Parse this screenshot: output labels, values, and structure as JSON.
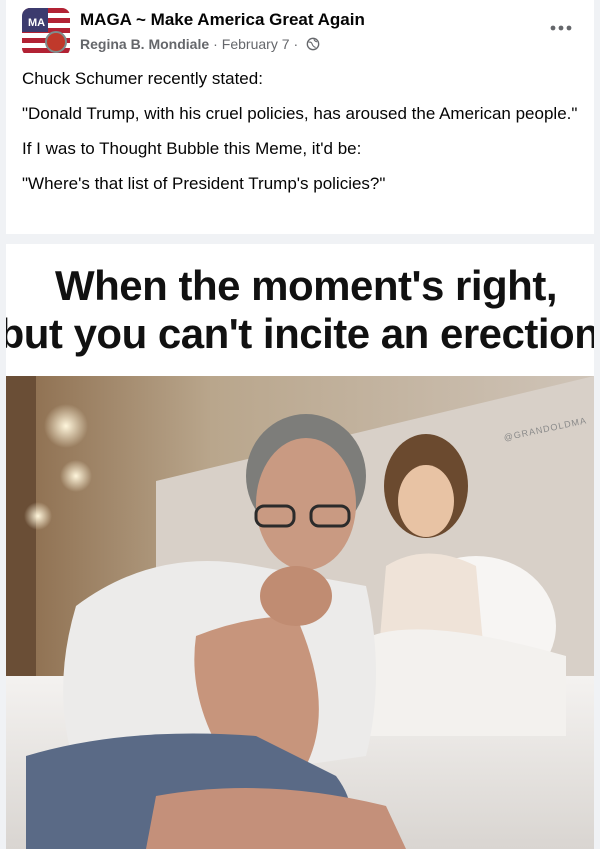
{
  "post": {
    "group_name": "MAGA ~ Make America Great Again",
    "author": "Regina B. Mondiale",
    "date": "February 7",
    "separator": "·",
    "privacy_icon": "globe-icon",
    "more_icon": "more-options-icon",
    "avatar_text": "MA",
    "paragraphs": [
      "Chuck Schumer recently stated:",
      "\"Donald Trump, with his cruel policies, has aroused the American people.\"",
      "If I was to Thought Bubble this Meme, it'd be:",
      "\"Where's that list of President Trump's policies?\""
    ]
  },
  "meme": {
    "caption_line1": "When the moment's right,",
    "caption_line2": "but you can't incite an erection",
    "watermark": "@GRANDOLDMA"
  },
  "colors": {
    "text_primary": "#050505",
    "text_secondary": "#65676b",
    "background": "#f0f2f5"
  }
}
